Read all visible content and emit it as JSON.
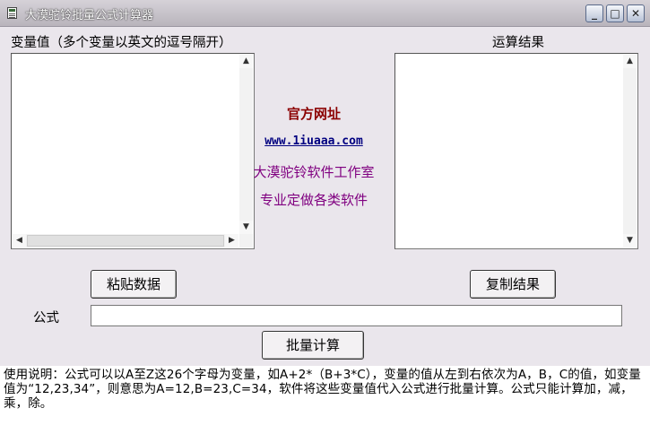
{
  "window": {
    "title": "大漠驼铃批量公式计算器",
    "controls": [
      "_",
      "□",
      "✕"
    ]
  },
  "left_panel": {
    "label": "变量值（多个变量以英文的逗号隔开）",
    "value": ""
  },
  "right_panel": {
    "label": "运算结果",
    "value": ""
  },
  "center": {
    "heading": "官方网址",
    "url": "www.1iuaaa.com",
    "studio": "大漠驼铃软件工作室",
    "tagline": "专业定做各类软件",
    "heading_color": "#8b0000",
    "url_color": "#000080",
    "studio_color": "#800080"
  },
  "buttons": {
    "paste": "粘贴数据",
    "copy": "复制结果",
    "calc": "批量计算"
  },
  "formula": {
    "label": "公式",
    "value": ""
  },
  "instructions": "使用说明：公式可以以A至Z这26个字母为变量，如A+2*（B+3*C），变量的值从左到右依次为A，B，C的值，如变量值为“12,23,34”，则意思为A=12,B=23,C=34，软件将这些变量值代入公式进行批量计算。公式只能计算加，减，乘，除。",
  "icons": {
    "scroll_up": "▲",
    "scroll_down": "▼",
    "scroll_left": "◀",
    "scroll_right": "▶"
  }
}
